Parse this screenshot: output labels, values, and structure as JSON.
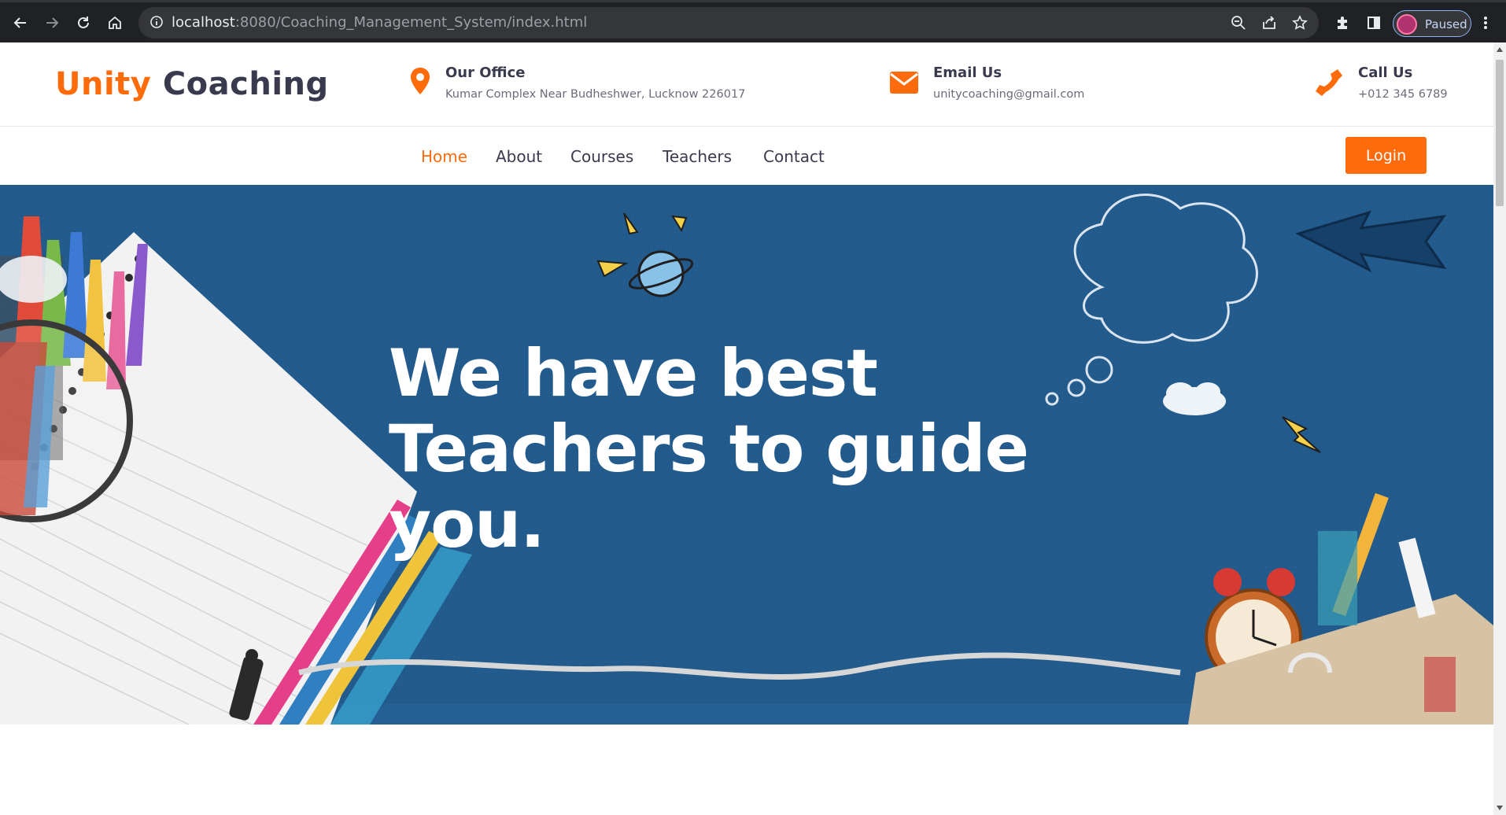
{
  "browser": {
    "url_host": "localhost",
    "url_rest": ":8080/Coaching_Management_System/index.html",
    "profile_label": "Paused",
    "icons": [
      "back-icon",
      "forward-icon",
      "reload-icon",
      "home-icon",
      "info-icon",
      "zoom-icon",
      "share-icon",
      "star-icon",
      "extensions-icon",
      "side-panel-icon",
      "menu-dots-icon"
    ]
  },
  "brand": {
    "part1": "Unity",
    "part2": "Coaching"
  },
  "contact": {
    "office": {
      "title": "Our Office",
      "text": "Kumar Complex Near Budheshwer, Lucknow 226017",
      "icon": "map-pin-icon"
    },
    "email": {
      "title": "Email Us",
      "text": "unitycoaching@gmail.com",
      "icon": "envelope-icon"
    },
    "phone": {
      "title": "Call Us",
      "text": "+012 345 6789",
      "icon": "phone-icon"
    }
  },
  "nav": {
    "items": [
      {
        "label": "Home",
        "active": true
      },
      {
        "label": "About",
        "active": false
      },
      {
        "label": "Courses",
        "active": false
      },
      {
        "label": "Teachers",
        "active": false
      },
      {
        "label": "Contact",
        "active": false
      }
    ],
    "login_label": "Login"
  },
  "hero": {
    "lines": [
      "We have best",
      "Teachers to guide",
      "you."
    ]
  },
  "colors": {
    "accent": "#fe6b0b",
    "dark_text": "#3a3a4e",
    "hero_bg": "#225a8c"
  }
}
